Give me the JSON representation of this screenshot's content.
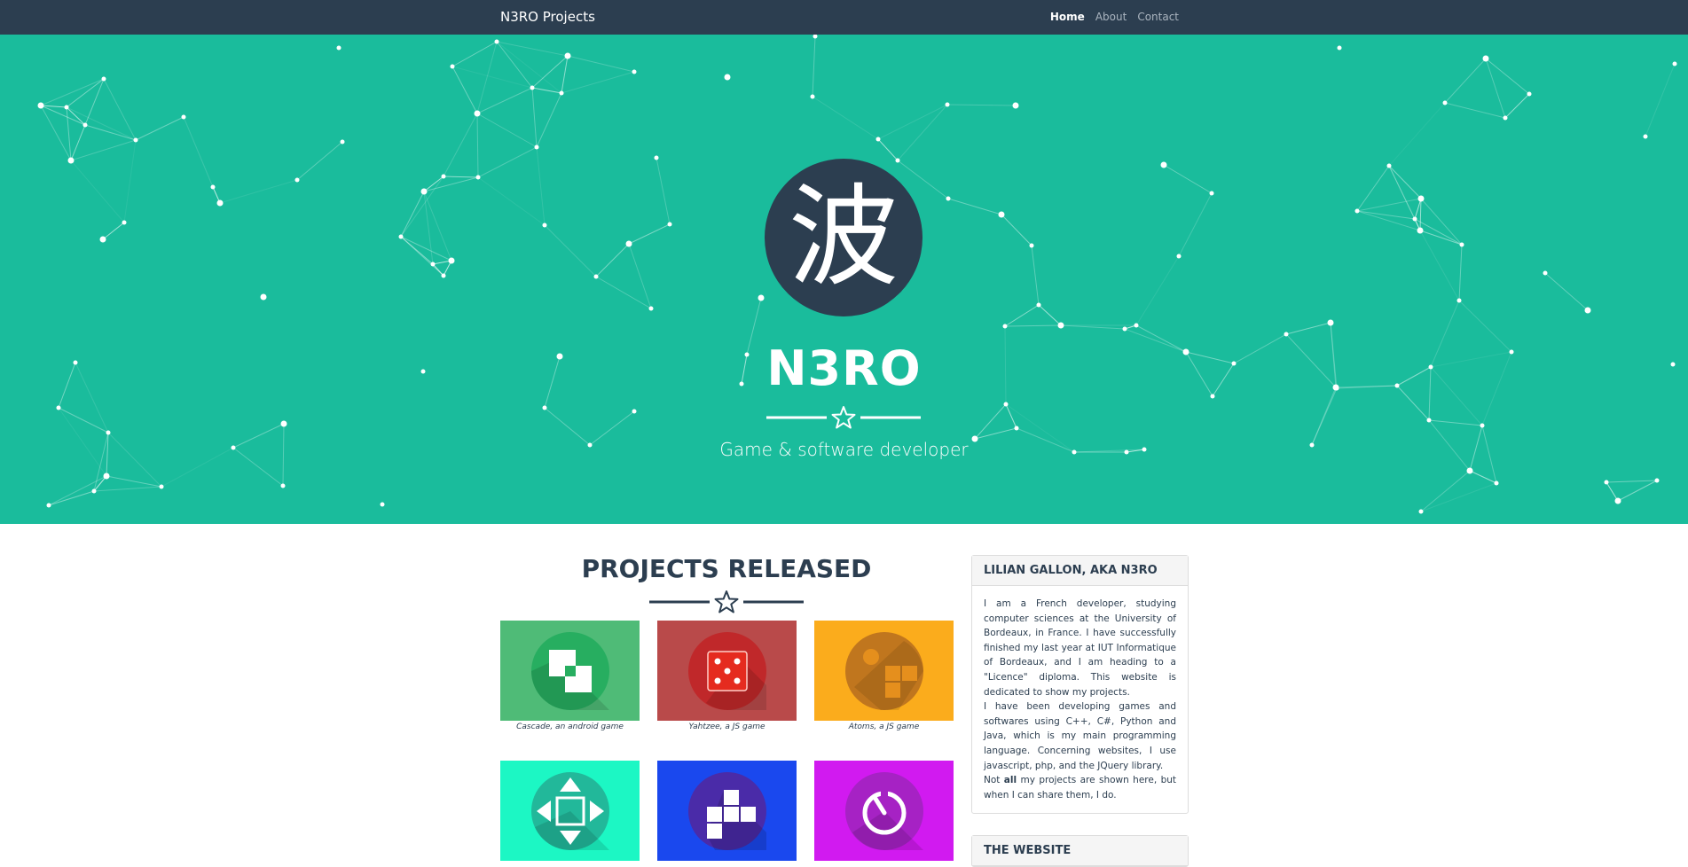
{
  "navbar": {
    "brand": "N3RO Projects",
    "links": [
      {
        "label": "Home",
        "active": true
      },
      {
        "label": "About",
        "active": false
      },
      {
        "label": "Contact",
        "active": false
      }
    ],
    "background": "#2c3e50"
  },
  "hero": {
    "logo_glyph": "波",
    "title": "N3RO",
    "subtitle": "Game & software developer",
    "background": "#1abc9c",
    "divider_icon": "star-icon"
  },
  "projects": {
    "title": "PROJECTS RELEASED",
    "divider_icon": "star-icon",
    "items": [
      {
        "caption": "Cascade, an android game",
        "bg": "#4fbb77",
        "disc": "#27ae60",
        "icon": "cascade-icon"
      },
      {
        "caption": "Yahtzee, a JS game",
        "bg": "#b94a4a",
        "disc": "#c0282a",
        "icon": "dice-icon"
      },
      {
        "caption": "Atoms, a JS game",
        "bg": "#fbac1c",
        "disc": "#c0761e",
        "icon": "atoms-icon"
      },
      {
        "caption": "",
        "bg": "#1cf7c4",
        "disc": "#22b89a",
        "icon": "arrows-icon"
      },
      {
        "caption": "",
        "bg": "#1a48ee",
        "disc": "#4a2ba8",
        "icon": "blocks-icon"
      },
      {
        "caption": "",
        "bg": "#d11af0",
        "disc": "#a622c4",
        "icon": "timer-icon"
      }
    ]
  },
  "sidebar": {
    "about": {
      "title": "Lilian Gallon, aka N3RO",
      "paragraph1": "I am a French developer, studying computer sciences at the University of Bordeaux, in France. I have successfully finished my last year at IUT Informatique of Bordeaux, and I am heading to a \"Licence\" diploma. This website is dedicated to show my projects.",
      "paragraph2": "I have been developing games and softwares using C++, C#, Python and Java, which is my main programming language. Concerning websites, I use javascript, php, and the JQuery library.",
      "paragraph3_pre": "Not ",
      "paragraph3_bold": "all",
      "paragraph3_post": " my projects are shown here, but when I can share them, I do."
    },
    "website": {
      "title": "The website"
    }
  },
  "colors": {
    "accent": "#1abc9c",
    "dark": "#2c3e50"
  }
}
